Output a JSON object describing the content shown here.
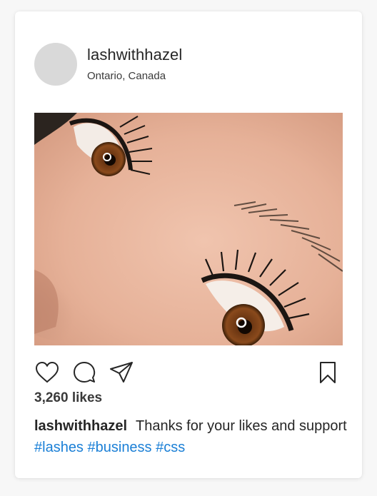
{
  "post": {
    "username": "lashwithhazel",
    "location": "Ontario, Canada",
    "likes": "3,260 likes",
    "caption": {
      "username": "lashwithhazel",
      "text": "Thanks for your likes and support",
      "hashtags": [
        "#lashes",
        "#business",
        "#css"
      ]
    },
    "image": {
      "subject": "close-up of eyes with eyelash extensions"
    }
  },
  "colors": {
    "hashtag": "#1a7fd6",
    "avatar_placeholder": "#d9d9d9",
    "text": "#262626"
  },
  "icons": {
    "like": "heart-icon",
    "comment": "comment-icon",
    "share": "paper-plane-icon",
    "save": "bookmark-icon"
  }
}
